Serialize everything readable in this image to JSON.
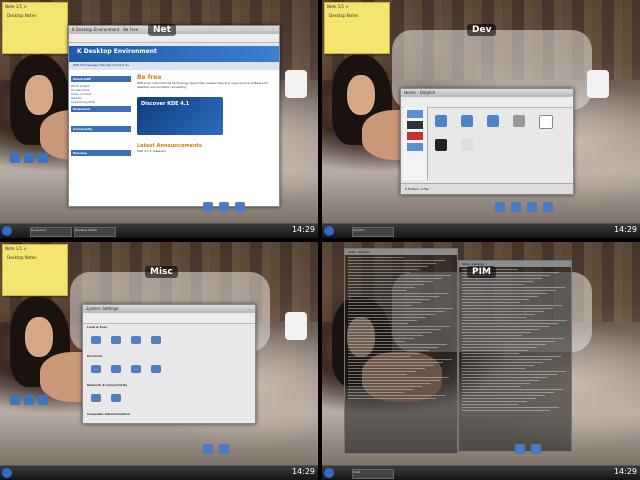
{
  "desktops": [
    {
      "name": "Net"
    },
    {
      "name": "Dev"
    },
    {
      "name": "Misc"
    },
    {
      "name": "PIM"
    }
  ],
  "clock": "14:29",
  "sticky": {
    "head": "Note 1/1 ×",
    "body": "Desktop Notes"
  },
  "browser": {
    "title": "K Desktop Environment - Be Free",
    "tabs": "KDE Homepages   Sitemap   Contact Us",
    "header": "K Desktop Environment",
    "nav_sections": [
      "About KDE",
      "Download",
      "Community",
      "Develop"
    ],
    "nav_links": [
      "What is KDE",
      "Screenshots",
      "Press Contact",
      "Awards",
      "Supporting KDE"
    ],
    "heading": "Be free",
    "intro": "KDE is an international technology team that creates free and open source software for desktop and portable computing.",
    "banner": "Discover KDE 4.1",
    "announce_heading": "Latest Announcements",
    "announce_text": "KDE 4.1.1 released"
  },
  "dolphin": {
    "title": "Home - Dolphin",
    "status": "5 Folders, 1 File"
  },
  "sysset": {
    "title": "System Settings",
    "sections": [
      "Look & Feel",
      "Personal",
      "Network & Connectivity",
      "Computer Administration"
    ]
  },
  "konsole": {
    "left_title": "Shell - Konsole",
    "right_title": "Shell - Konsole"
  },
  "tasks": [
    "Konqueror",
    "Desktop Notes",
    "Dolphin",
    "Shell"
  ]
}
